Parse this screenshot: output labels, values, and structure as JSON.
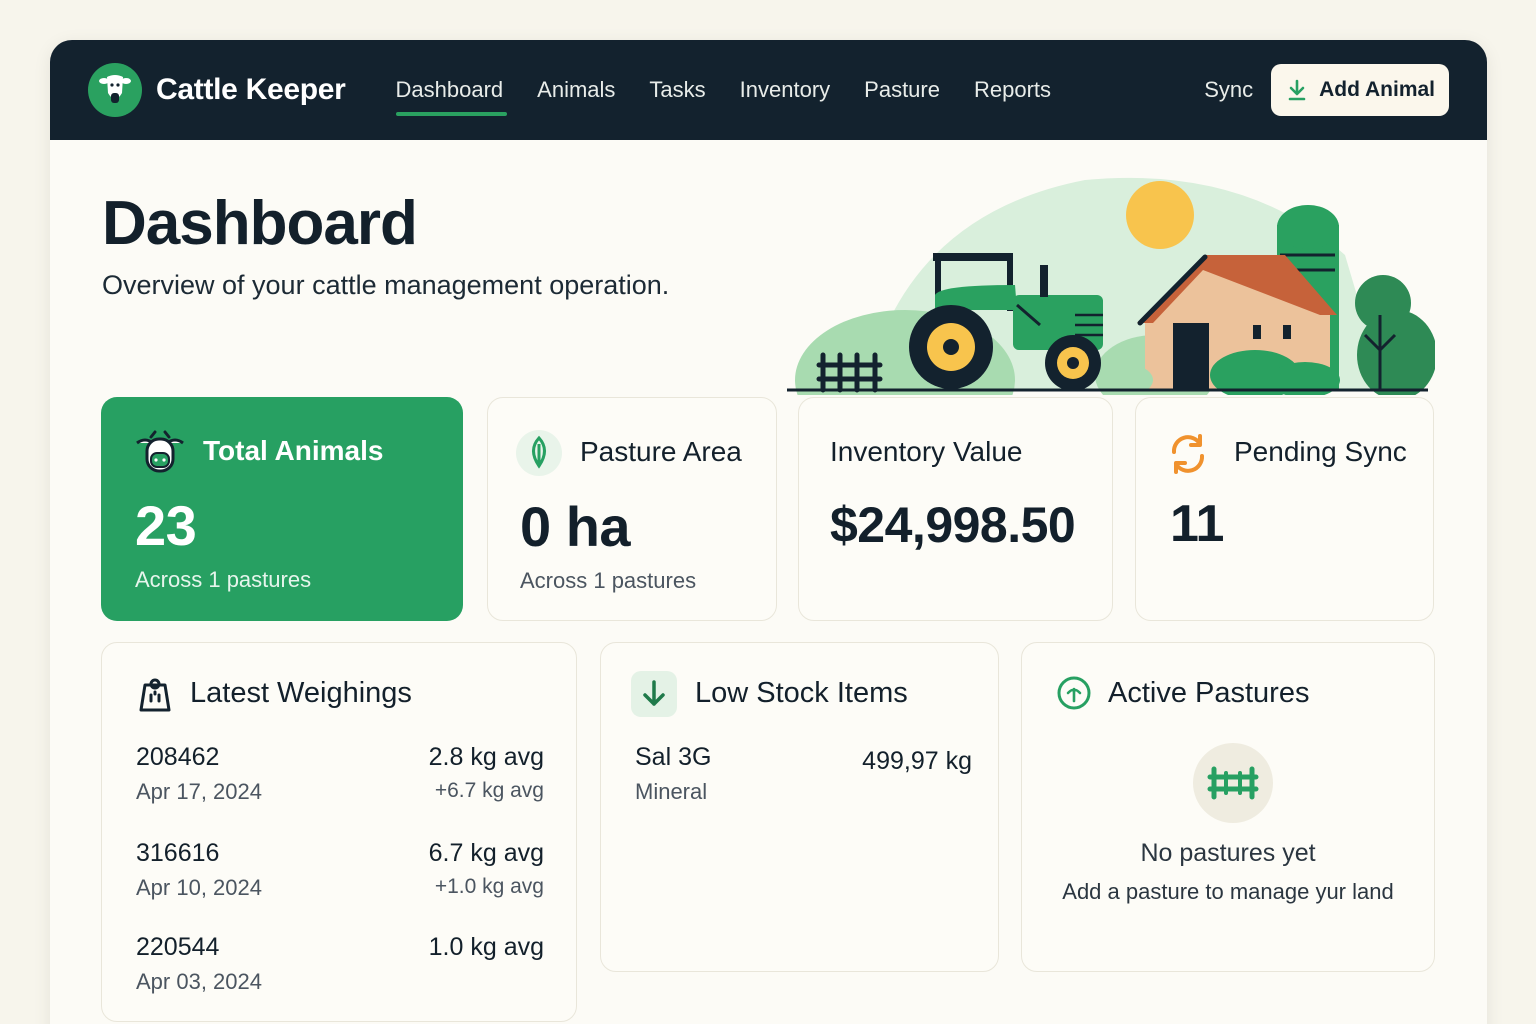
{
  "app": {
    "name": "Cattle Keeper"
  },
  "nav": {
    "links": [
      "Dashboard",
      "Animals",
      "Tasks",
      "Inventory",
      "Pasture",
      "Reports"
    ],
    "active": "Dashboard",
    "sync_label": "Sync",
    "add_button_label": "Add Animal"
  },
  "header": {
    "title": "Dashboard",
    "subtitle": "Overview of your cattle management operation."
  },
  "stats": {
    "total_animals": {
      "title": "Total Animals",
      "value": "23",
      "foot": "Across 1 pastures"
    },
    "pasture_area": {
      "title": "Pasture Area",
      "value": "0 ha",
      "foot": "Across 1 pastures"
    },
    "inventory_value": {
      "title": "Inventory Value",
      "value": "$24,998.50"
    },
    "pending_sync": {
      "title": "Pending Sync",
      "value": "11"
    }
  },
  "weighings": {
    "title": "Latest Weighings",
    "rows": [
      {
        "id": "208462",
        "date": "Apr 17, 2024",
        "avg": "2.8 kg avg",
        "delta": "+6.7 kg avg"
      },
      {
        "id": "316616",
        "date": "Apr 10, 2024",
        "avg": "6.7 kg avg",
        "delta": "+1.0 kg avg"
      },
      {
        "id": "220544",
        "date": "Apr 03, 2024",
        "avg": "1.0 kg avg",
        "delta": ""
      }
    ]
  },
  "low_stock": {
    "title": "Low Stock Items",
    "items": [
      {
        "name": "Sal 3G",
        "category": "Mineral",
        "qty": "499,97 kg"
      }
    ]
  },
  "active_pastures": {
    "title": "Active Pastures",
    "empty_title": "No pastures yet",
    "empty_sub": "Add a pasture to manage yur land"
  },
  "colors": {
    "nav_bg": "#13222e",
    "brand_green": "#27a062",
    "accent_orange": "#f0922e",
    "page_bg": "#f7f5ec"
  },
  "icons": {
    "logo": "cow-head-icon",
    "add": "download-arrow-icon",
    "total_animals": "cow-face-icon",
    "pasture_area": "leaf-icon",
    "pending_sync": "sync-arrows-icon",
    "weighings": "scale-weight-icon",
    "low_stock": "arrow-down-icon",
    "active_pastures": "sprout-circle-icon",
    "empty_pastures": "fence-icon"
  }
}
